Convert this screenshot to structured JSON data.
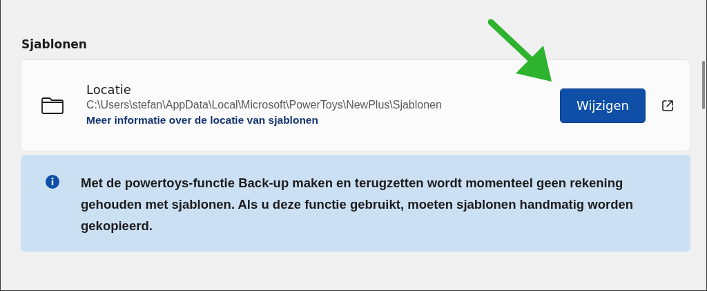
{
  "section_title": "Sjablonen",
  "location_card": {
    "label": "Locatie",
    "path": "C:\\Users\\stefan\\AppData\\Local\\Microsoft\\PowerToys\\NewPlus\\Sjablonen",
    "link": "Meer informatie over de locatie van sjablonen",
    "button": "Wijzigen"
  },
  "info_bar": {
    "text": "Met de powertoys-functie Back-up maken en terugzetten wordt momenteel geen rekening gehouden met sjablonen. Als u deze functie gebruikt, moeten sjablonen handmatig worden gekopieerd."
  }
}
